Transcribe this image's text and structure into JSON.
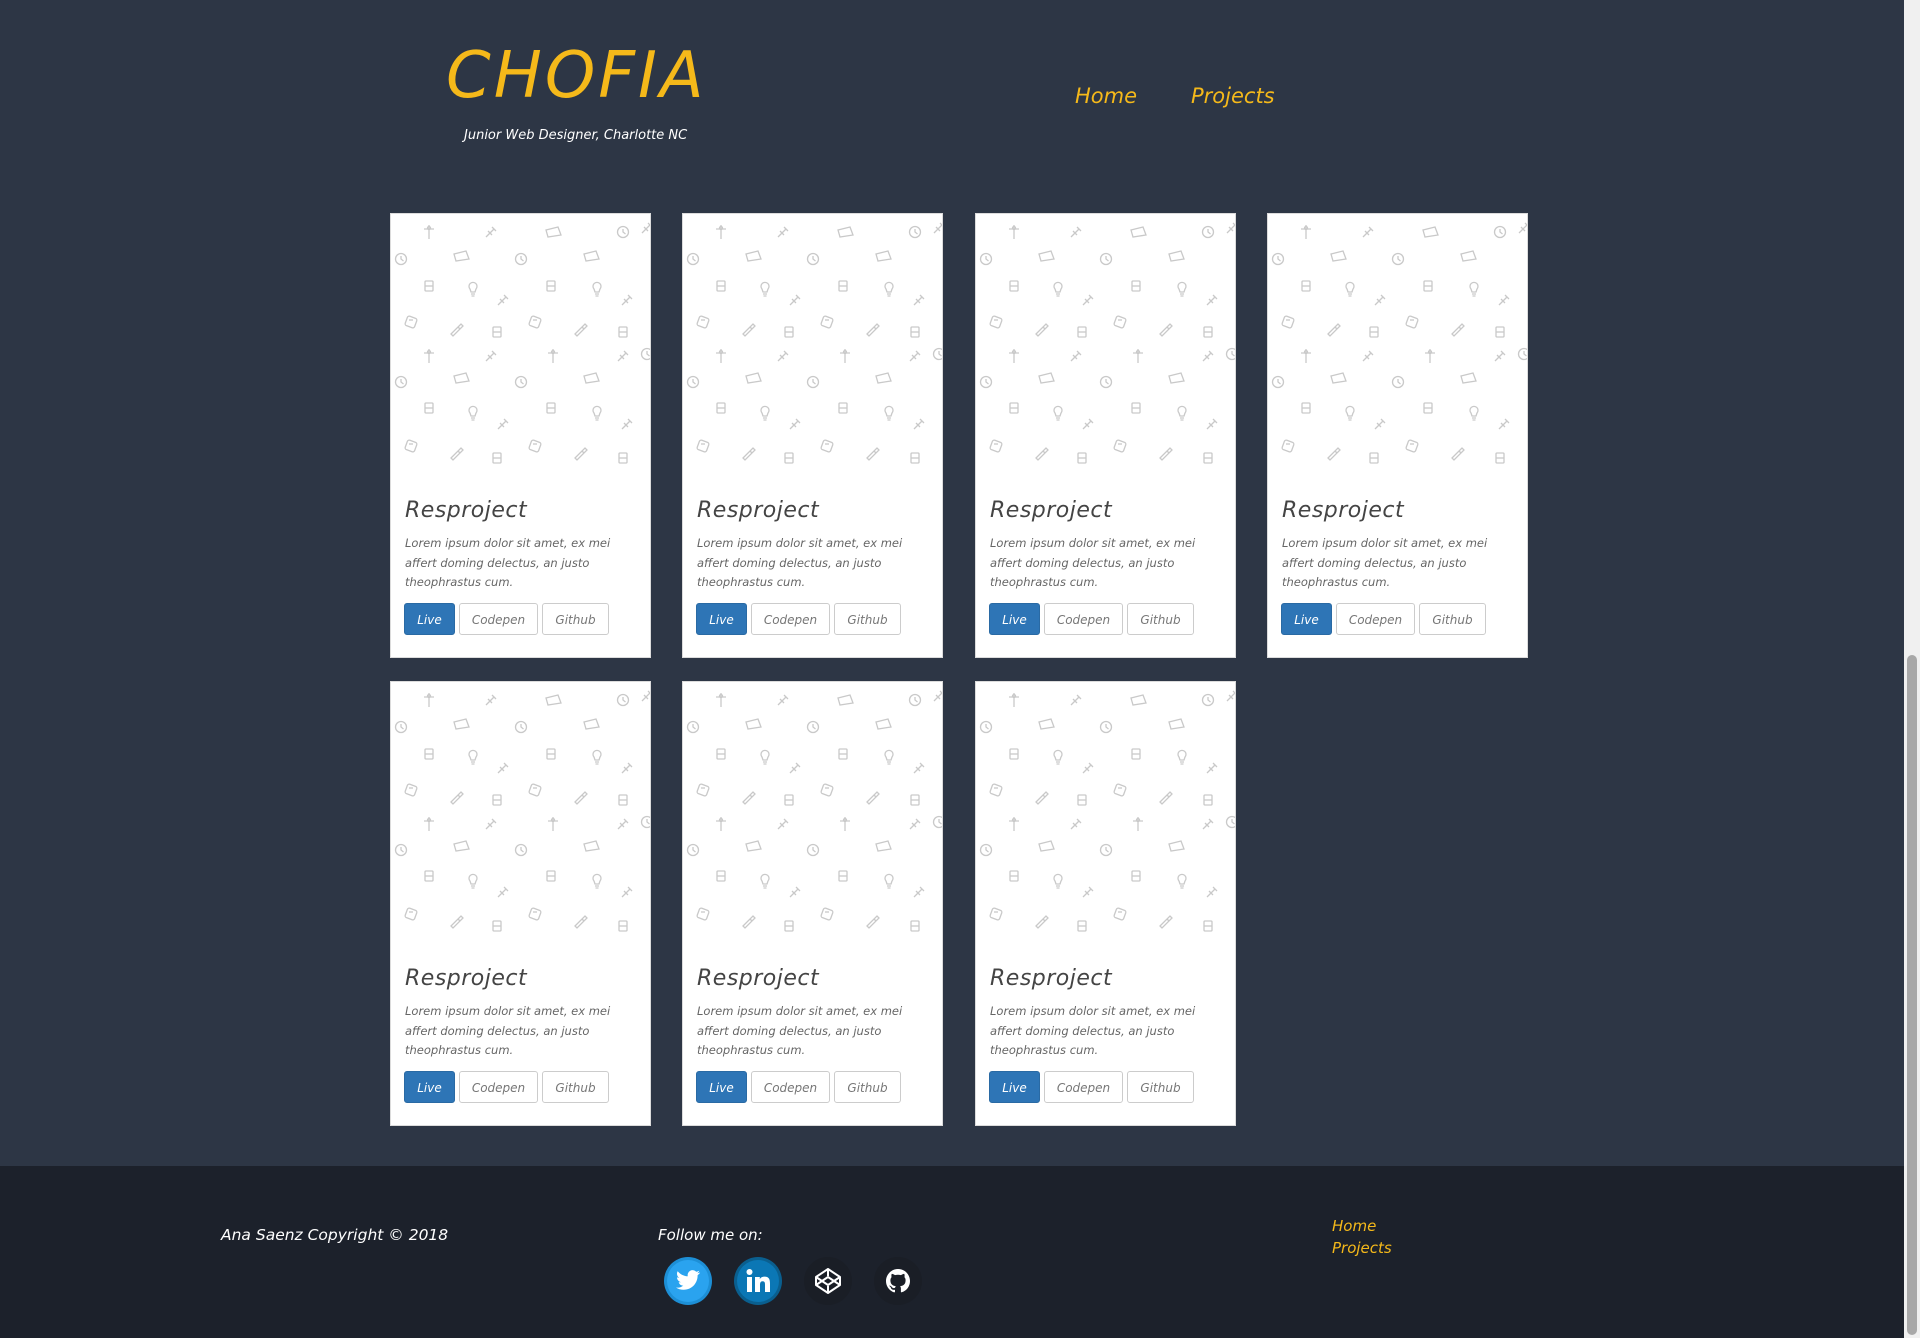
{
  "header": {
    "logo": "CHOFIA",
    "tagline": "Junior Web Designer, Charlotte NC",
    "nav": [
      {
        "label": "Home"
      },
      {
        "label": "Projects"
      }
    ]
  },
  "projects": [
    {
      "title": "Resproject",
      "description": "Lorem ipsum dolor sit amet, ex mei affert doming delectus, an justo theophrastus cum.",
      "buttons": {
        "live": "Live",
        "codepen": "Codepen",
        "github": "Github"
      }
    },
    {
      "title": "Resproject",
      "description": "Lorem ipsum dolor sit amet, ex mei affert doming delectus, an justo theophrastus cum.",
      "buttons": {
        "live": "Live",
        "codepen": "Codepen",
        "github": "Github"
      }
    },
    {
      "title": "Resproject",
      "description": "Lorem ipsum dolor sit amet, ex mei affert doming delectus, an justo theophrastus cum.",
      "buttons": {
        "live": "Live",
        "codepen": "Codepen",
        "github": "Github"
      }
    },
    {
      "title": "Resproject",
      "description": "Lorem ipsum dolor sit amet, ex mei affert doming delectus, an justo theophrastus cum.",
      "buttons": {
        "live": "Live",
        "codepen": "Codepen",
        "github": "Github"
      }
    },
    {
      "title": "Resproject",
      "description": "Lorem ipsum dolor sit amet, ex mei affert doming delectus, an justo theophrastus cum.",
      "buttons": {
        "live": "Live",
        "codepen": "Codepen",
        "github": "Github"
      }
    },
    {
      "title": "Resproject",
      "description": "Lorem ipsum dolor sit amet, ex mei affert doming delectus, an justo theophrastus cum.",
      "buttons": {
        "live": "Live",
        "codepen": "Codepen",
        "github": "Github"
      }
    },
    {
      "title": "Resproject",
      "description": "Lorem ipsum dolor sit amet, ex mei affert doming delectus, an justo theophrastus cum.",
      "buttons": {
        "live": "Live",
        "codepen": "Codepen",
        "github": "Github"
      }
    }
  ],
  "footer": {
    "copyright": "Ana Saenz Copyright © 2018",
    "follow_label": "Follow me on:",
    "socials": [
      {
        "icon": "twitter-icon"
      },
      {
        "icon": "linkedin-icon"
      },
      {
        "icon": "codepen-icon"
      },
      {
        "icon": "github-icon"
      }
    ],
    "nav": [
      {
        "label": "Home"
      },
      {
        "label": "Projects"
      }
    ]
  },
  "colors": {
    "background": "#2d3645",
    "footer": "#1c212b",
    "accent": "#f5b91a",
    "live_button": "#2e75b6"
  }
}
